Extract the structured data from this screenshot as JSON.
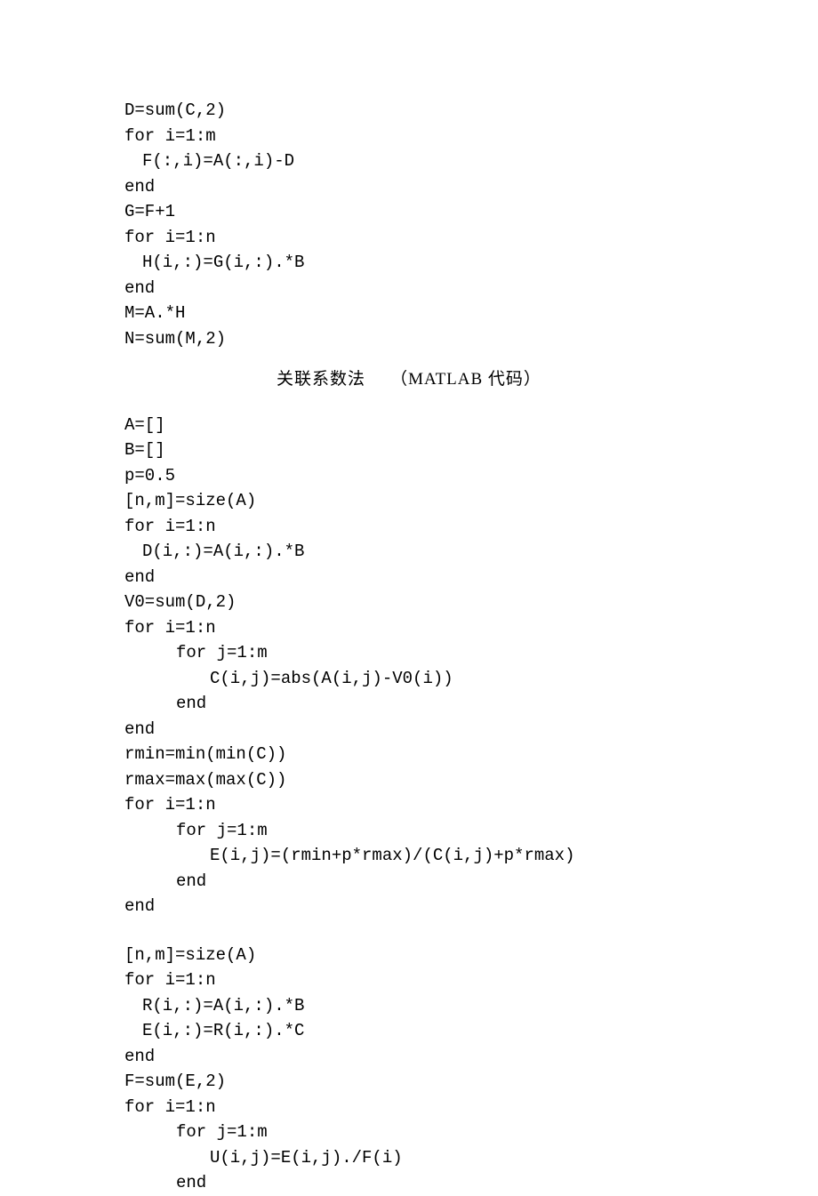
{
  "block1": {
    "l1": "D=sum(C,2)",
    "l2": "for i=1:m",
    "l3": "F(:,i)=A(:,i)-D",
    "l4": "end",
    "l5": "G=F+1",
    "l6": "for i=1:n",
    "l7": "H(i,:)=G(i,:).*B",
    "l8": "end",
    "l9": "M=A.*H",
    "l10": "N=sum(M,2)"
  },
  "section": {
    "title_left": "关联系数法",
    "title_right": "（MATLAB 代码）"
  },
  "block2": {
    "l1": "A=[]",
    "l2": "B=[]",
    "l3": "p=0.5",
    "l4": "[n,m]=size(A)",
    "l5": "for i=1:n",
    "l6": "D(i,:)=A(i,:).*B",
    "l7": "end",
    "l8": "V0=sum(D,2)",
    "l9": "for i=1:n",
    "l10": "for j=1:m",
    "l11": "C(i,j)=abs(A(i,j)-V0(i))",
    "l12": "end",
    "l13": "end",
    "l14": "rmin=min(min(C))",
    "l15": "rmax=max(max(C))",
    "l16": "for i=1:n",
    "l17": "for j=1:m",
    "l18": "E(i,j)=(rmin+p*rmax)/(C(i,j)+p*rmax)",
    "l19": "end",
    "l20": "end"
  },
  "block3": {
    "l1": "[n,m]=size(A)",
    "l2": "for i=1:n",
    "l3": "R(i,:)=A(i,:).*B",
    "l4": "E(i,:)=R(i,:).*C",
    "l5": "end",
    "l6": "F=sum(E,2)",
    "l7": "for i=1:n",
    "l8": "for j=1:m",
    "l9": "U(i,j)=E(i,j)./F(i)",
    "l10": "end"
  }
}
